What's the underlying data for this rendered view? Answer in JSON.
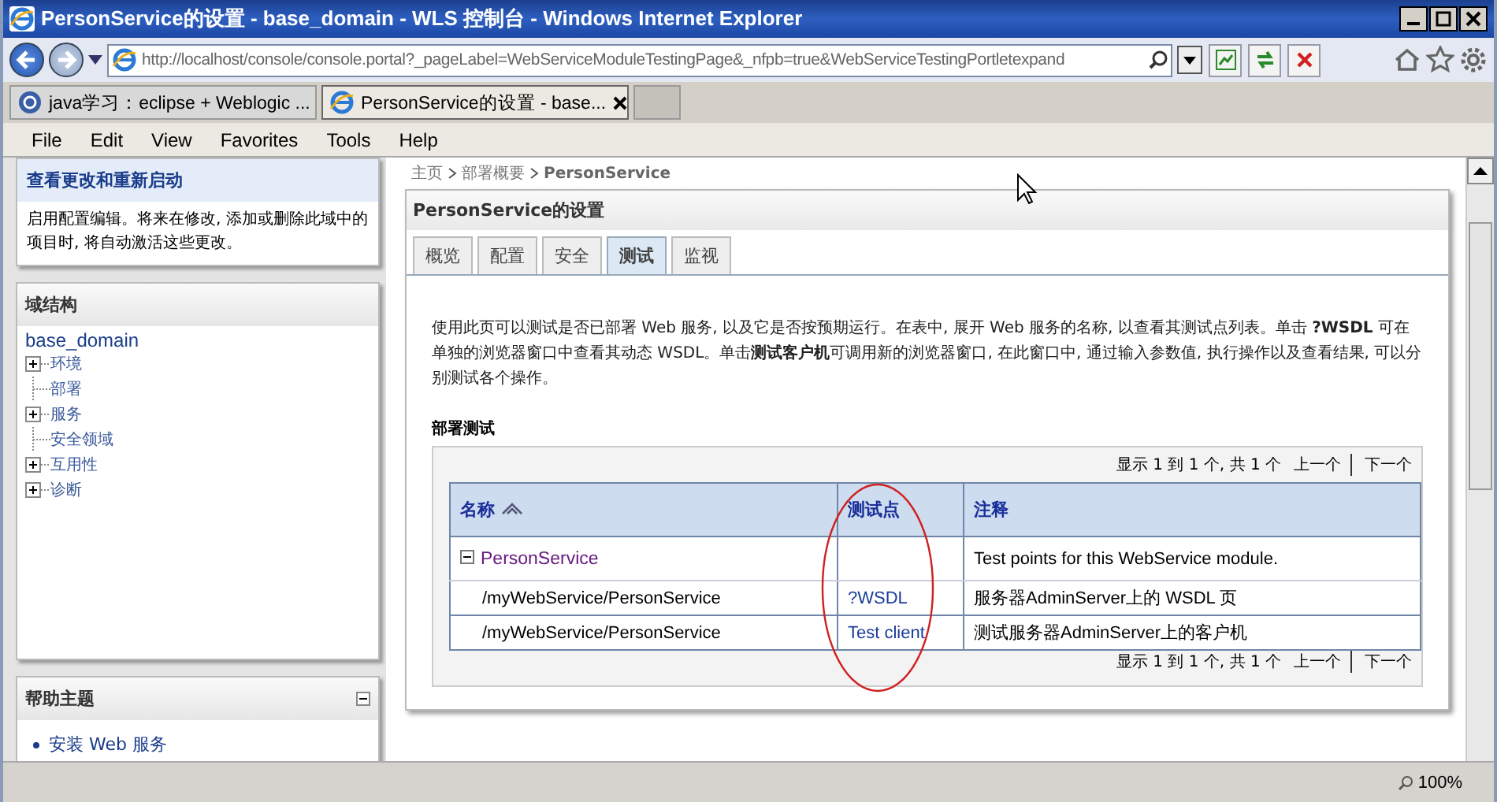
{
  "window": {
    "title": "PersonService的设置 - base_domain - WLS 控制台 - Windows Internet Explorer"
  },
  "address_bar": {
    "url": "http://localhost/console/console.portal?_pageLabel=WebServiceModuleTestingPage&_nfpb=true&WebServiceTestingPortletexpand"
  },
  "browser_tabs": [
    {
      "label": "java学习：eclipse + Weblogic ...",
      "selected": false
    },
    {
      "label": "PersonService的设置 - base...",
      "selected": true
    }
  ],
  "menu": [
    "File",
    "Edit",
    "View",
    "Favorites",
    "Tools",
    "Help"
  ],
  "change_center": {
    "title": "查看更改和重新启动",
    "text": "启用配置编辑。将来在修改, 添加或删除此域中的项目时, 将自动激活这些更改。"
  },
  "domain_structure": {
    "title": "域结构",
    "root": "base_domain",
    "items": [
      {
        "label": "环境",
        "expandable": true
      },
      {
        "label": "部署",
        "expandable": false
      },
      {
        "label": "服务",
        "expandable": true
      },
      {
        "label": "安全领域",
        "expandable": false
      },
      {
        "label": "互用性",
        "expandable": true
      },
      {
        "label": "诊断",
        "expandable": true
      }
    ]
  },
  "help_topics": {
    "title": "帮助主题",
    "items": [
      "安装 Web 服务"
    ]
  },
  "breadcrumb": [
    "主页",
    "部署概要",
    "PersonService"
  ],
  "panel": {
    "title": "PersonService的设置",
    "tabs": [
      {
        "label": "概览",
        "selected": false
      },
      {
        "label": "配置",
        "selected": false
      },
      {
        "label": "安全",
        "selected": false
      },
      {
        "label": "测试",
        "selected": true
      },
      {
        "label": "监视",
        "selected": false
      }
    ],
    "description": "使用此页可以测试是否已部署 Web 服务, 以及它是否按预期运行。在表中, 展开 Web 服务的名称, 以查看其测试点列表。单击 **?WSDL** 可在单独的浏览器窗口中查看其动态 WSDL。单击**测试客户机**可调用新的浏览器窗口, 在此窗口中, 通过输入参数值, 执行操作以及查看结果, 可以分别测试各个操作。",
    "section_title": "部署测试",
    "pagers": [
      {
        "text": "显示 1 到 1 个, 共 1 个",
        "previous": "上一个",
        "next": "下一个"
      },
      {
        "text": "显示 1 到 1 个, 共 1 个",
        "previous": "上一个",
        "next": "下一个"
      }
    ],
    "columns": [
      "名称",
      "测试点",
      "注释"
    ],
    "rows": [
      {
        "kind": "module",
        "name": "PersonService",
        "test_point": "",
        "comment": "Test points for this WebService module."
      },
      {
        "kind": "endpoint",
        "name": "/myWebService/PersonService",
        "test_point": "?WSDL",
        "comment": "服务器AdminServer上的 WSDL 页"
      },
      {
        "kind": "endpoint",
        "name": "/myWebService/PersonService",
        "test_point": "Test client",
        "comment": "测试服务器AdminServer上的客户机"
      }
    ]
  },
  "status_bar": {
    "zoom": "100%"
  }
}
